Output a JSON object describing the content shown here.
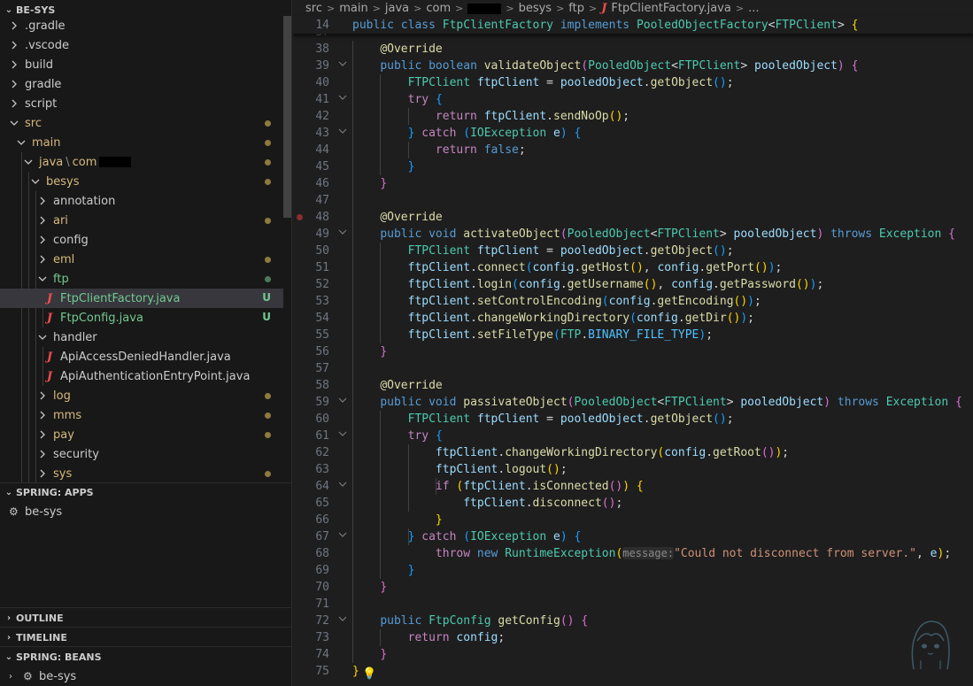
{
  "explorer": {
    "title": "BE-SYS",
    "tree": [
      {
        "label": "gradle_dot",
        "text": ".gradle",
        "depth": 1,
        "kind": "folder"
      },
      {
        "text": ".vscode",
        "depth": 1,
        "kind": "folder"
      },
      {
        "text": "build",
        "depth": 1,
        "kind": "folder"
      },
      {
        "text": "gradle",
        "depth": 1,
        "kind": "folder"
      },
      {
        "text": "script",
        "depth": 1,
        "kind": "folder"
      },
      {
        "text": "src",
        "depth": 1,
        "kind": "folder-open",
        "color": "yellow",
        "dot": true
      },
      {
        "text": "main",
        "depth": 2,
        "kind": "folder-open",
        "color": "yellow",
        "dot": true
      },
      {
        "text": "java",
        "text2": "com",
        "depth": 3,
        "kind": "folder-open",
        "color": "yellow",
        "dot": true,
        "redact": true
      },
      {
        "text": "besys",
        "depth": 4,
        "kind": "folder-open",
        "color": "yellow",
        "dot": true
      },
      {
        "text": "annotation",
        "depth": 5,
        "kind": "folder"
      },
      {
        "text": "ari",
        "depth": 5,
        "kind": "folder",
        "color": "yellow",
        "dot": true
      },
      {
        "text": "config",
        "depth": 5,
        "kind": "folder"
      },
      {
        "text": "eml",
        "depth": 5,
        "kind": "folder",
        "color": "yellow",
        "dot": true
      },
      {
        "text": "ftp",
        "depth": 5,
        "kind": "folder-open",
        "color": "green",
        "dot": true,
        "dotcolor": "#4e7a5c"
      },
      {
        "text": "FtpClientFactory.java",
        "depth": 6,
        "kind": "java",
        "color": "green",
        "badge": "U",
        "selected": true
      },
      {
        "text": "FtpConfig.java",
        "depth": 6,
        "kind": "java",
        "color": "green",
        "badge": "U"
      },
      {
        "text": "handler",
        "depth": 5,
        "kind": "folder-open"
      },
      {
        "text": "ApiAccessDeniedHandler.java",
        "depth": 6,
        "kind": "java"
      },
      {
        "text": "ApiAuthenticationEntryPoint.java",
        "depth": 6,
        "kind": "java"
      },
      {
        "text": "log",
        "depth": 5,
        "kind": "folder",
        "color": "yellow",
        "dot": true
      },
      {
        "text": "mms",
        "depth": 5,
        "kind": "folder",
        "color": "yellow",
        "dot": true
      },
      {
        "text": "pay",
        "depth": 5,
        "kind": "folder",
        "color": "yellow",
        "dot": true
      },
      {
        "text": "security",
        "depth": 5,
        "kind": "folder"
      },
      {
        "text": "sys",
        "depth": 5,
        "kind": "folder",
        "color": "yellow",
        "dot": true
      }
    ]
  },
  "spring_apps": {
    "title": "SPRING: APPS",
    "item": "be-sys"
  },
  "outline": {
    "title": "OUTLINE"
  },
  "timeline": {
    "title": "TIMELINE"
  },
  "spring_beans": {
    "title": "SPRING: BEANS",
    "item": "be-sys"
  },
  "breadcrumb": {
    "parts": [
      "src",
      "main",
      "java",
      "com"
    ],
    "after": [
      "besys",
      "ftp"
    ],
    "file": "FtpClientFactory.java",
    "tail": "..."
  },
  "code": {
    "lines": [
      {
        "n": "14",
        "html": "<span class='kw'>public</span> <span class='kw'>class</span> <span class='ty'>FtpClientFactory</span> <span class='kw'>implements</span> <span class='ty'>PooledObjectFactory</span>&lt;<span class='ty'>FTPClient</span>&gt; <span class='b1'>{</span>",
        "sticky": true
      },
      {
        "n": "37",
        "html": "",
        "partial": true
      },
      {
        "n": "38",
        "html": "    <span class='an'>@Override</span>"
      },
      {
        "n": "39",
        "html": "    <span class='kw'>public</span> <span class='kw'>boolean</span> <span class='fn'>validateObject</span><span class='b2'>(</span><span class='ty'>PooledObject</span>&lt;<span class='ty'>FTPClient</span>&gt; <span class='var'>pooledObject</span><span class='b2'>)</span> <span class='b2'>{</span>",
        "fold": true
      },
      {
        "n": "40",
        "html": "        <span class='ty'>FTPClient</span> <span class='var'>ftpClient</span> = <span class='var'>pooledObject</span>.<span class='fn'>getObject</span><span class='b3'>()</span>;"
      },
      {
        "n": "41",
        "html": "        <span class='ctl'>try</span> <span class='b3'>{</span>",
        "fold": true
      },
      {
        "n": "42",
        "html": "            <span class='ctl'>return</span> <span class='var'>ftpClient</span>.<span class='fn'>sendNoOp</span><span class='b1'>()</span>;"
      },
      {
        "n": "43",
        "html": "        <span class='b3'>}</span> <span class='ctl'>catch</span> <span class='b3'>(</span><span class='ty'>IOException</span> <span class='var'>e</span><span class='b3'>)</span> <span class='b3'>{</span>",
        "fold": true
      },
      {
        "n": "44",
        "html": "            <span class='ctl'>return</span> <span class='kw'>false</span>;"
      },
      {
        "n": "45",
        "html": "        <span class='b3'>}</span>"
      },
      {
        "n": "46",
        "html": "    <span class='b2'>}</span>"
      },
      {
        "n": "47",
        "html": ""
      },
      {
        "n": "48",
        "html": "    <span class='an'>@Override</span>",
        "bp": true
      },
      {
        "n": "49",
        "html": "    <span class='kw'>public</span> <span class='kw'>void</span> <span class='fn'>activateObject</span><span class='b2'>(</span><span class='ty'>PooledObject</span>&lt;<span class='ty'>FTPClient</span>&gt; <span class='var'>pooledObject</span><span class='b2'>)</span> <span class='kw'>throws</span> <span class='ty'>Exception</span> <span class='b2'>{</span>",
        "fold": true
      },
      {
        "n": "50",
        "html": "        <span class='ty'>FTPClient</span> <span class='var'>ftpClient</span> = <span class='var'>pooledObject</span>.<span class='fn'>getObject</span><span class='b3'>()</span>;"
      },
      {
        "n": "51",
        "html": "        <span class='var'>ftpClient</span>.<span class='fn'>connect</span><span class='b3'>(</span><span class='var'>config</span>.<span class='fn'>getHost</span><span class='b1'>()</span>, <span class='var'>config</span>.<span class='fn'>getPort</span><span class='b1'>()</span><span class='b3'>)</span>;"
      },
      {
        "n": "52",
        "html": "        <span class='var'>ftpClient</span>.<span class='fn'>login</span><span class='b3'>(</span><span class='var'>config</span>.<span class='fn'>getUsername</span><span class='b1'>()</span>, <span class='var'>config</span>.<span class='fn'>getPassword</span><span class='b1'>()</span><span class='b3'>)</span>;"
      },
      {
        "n": "53",
        "html": "        <span class='var'>ftpClient</span>.<span class='fn'>setControlEncoding</span><span class='b3'>(</span><span class='var'>config</span>.<span class='fn'>getEncoding</span><span class='b1'>()</span><span class='b3'>)</span>;"
      },
      {
        "n": "54",
        "html": "        <span class='var'>ftpClient</span>.<span class='fn'>changeWorkingDirectory</span><span class='b3'>(</span><span class='var'>config</span>.<span class='fn'>getDir</span><span class='b1'>()</span><span class='b3'>)</span>;"
      },
      {
        "n": "55",
        "html": "        <span class='var'>ftpClient</span>.<span class='fn'>setFileType</span><span class='b3'>(</span><span class='ty'>FTP</span>.<span class='cn'>BINARY_FILE_TYPE</span><span class='b3'>)</span>;"
      },
      {
        "n": "56",
        "html": "    <span class='b2'>}</span>"
      },
      {
        "n": "57",
        "html": ""
      },
      {
        "n": "58",
        "html": "    <span class='an'>@Override</span>"
      },
      {
        "n": "59",
        "html": "    <span class='kw'>public</span> <span class='kw'>void</span> <span class='fn'>passivateObject</span><span class='b2'>(</span><span class='ty'>PooledObject</span>&lt;<span class='ty'>FTPClient</span>&gt; <span class='var'>pooledObject</span><span class='b2'>)</span> <span class='kw'>throws</span> <span class='ty'>Exception</span> <span class='b2'>{</span>",
        "fold": true
      },
      {
        "n": "60",
        "html": "        <span class='ty'>FTPClient</span> <span class='var'>ftpClient</span> = <span class='var'>pooledObject</span>.<span class='fn'>getObject</span><span class='b3'>()</span>;"
      },
      {
        "n": "61",
        "html": "        <span class='ctl'>try</span> <span class='b3'>{</span>",
        "fold": true
      },
      {
        "n": "62",
        "html": "            <span class='var'>ftpClient</span>.<span class='fn'>changeWorkingDirectory</span><span class='b1'>(</span><span class='var'>config</span>.<span class='fn'>getRoot</span><span class='b2'>()</span><span class='b1'>)</span>;"
      },
      {
        "n": "63",
        "html": "            <span class='var'>ftpClient</span>.<span class='fn'>logout</span><span class='b1'>()</span>;"
      },
      {
        "n": "64",
        "html": "            <span class='ctl'>if</span> <span class='b1'>(</span><span class='var'>ftpClient</span>.<span class='fn'>isConnected</span><span class='b2'>()</span><span class='b1'>)</span> <span class='b1'>{</span>",
        "fold": true
      },
      {
        "n": "65",
        "html": "                <span class='var'>ftpClient</span>.<span class='fn'>disconnect</span><span class='b2'>()</span>;"
      },
      {
        "n": "66",
        "html": "            <span class='b1'>}</span>"
      },
      {
        "n": "67",
        "html": "        <span class='b3'>}</span> <span class='ctl'>catch</span> <span class='b3'>(</span><span class='ty'>IOException</span> <span class='var'>e</span><span class='b3'>)</span> <span class='b3'>{</span>",
        "fold": true
      },
      {
        "n": "68",
        "html": "            <span class='ctl'>throw</span> <span class='kw'>new</span> <span class='ty'>RuntimeException</span><span class='b1'>(</span><span class='hint'>message:</span><span class='str'>\"Could not disconnect from server.\"</span>, <span class='var'>e</span><span class='b1'>)</span>;"
      },
      {
        "n": "69",
        "html": "        <span class='b3'>}</span>"
      },
      {
        "n": "70",
        "html": "    <span class='b2'>}</span>"
      },
      {
        "n": "71",
        "html": ""
      },
      {
        "n": "72",
        "html": "    <span class='kw'>public</span> <span class='ty'>FtpConfig</span> <span class='fn'>getConfig</span><span class='b2'>()</span> <span class='b2'>{</span>",
        "fold": true
      },
      {
        "n": "73",
        "html": "        <span class='ctl'>return</span> <span class='var'>config</span>;"
      },
      {
        "n": "74",
        "html": "    <span class='b2'>}</span>"
      },
      {
        "n": "75",
        "html": "<span class='b1'>}</span>"
      }
    ]
  }
}
